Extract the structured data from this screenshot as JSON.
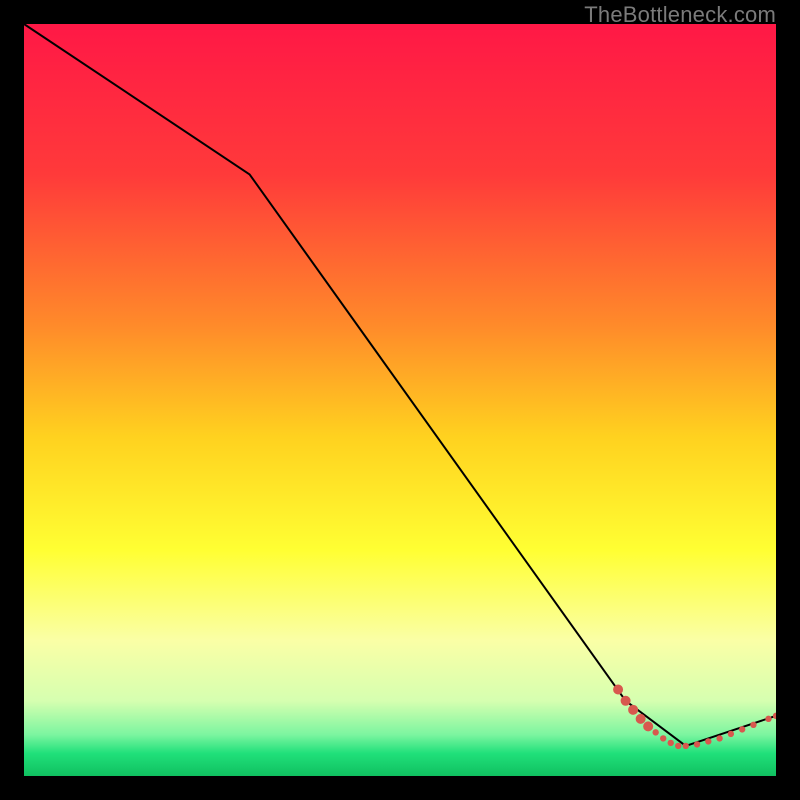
{
  "watermark": "TheBottleneck.com",
  "chart_data": {
    "type": "line",
    "title": "",
    "xlabel": "",
    "ylabel": "",
    "xlim": [
      0,
      100
    ],
    "ylim": [
      0,
      100
    ],
    "grid": false,
    "legend": false,
    "background_gradient_stops": [
      {
        "offset": 0.0,
        "color": "#ff1846"
      },
      {
        "offset": 0.2,
        "color": "#ff3a3a"
      },
      {
        "offset": 0.4,
        "color": "#ff8a2a"
      },
      {
        "offset": 0.55,
        "color": "#ffd21f"
      },
      {
        "offset": 0.7,
        "color": "#ffff33"
      },
      {
        "offset": 0.82,
        "color": "#faffa6"
      },
      {
        "offset": 0.9,
        "color": "#d6ffb0"
      },
      {
        "offset": 0.945,
        "color": "#7cf5a0"
      },
      {
        "offset": 0.97,
        "color": "#20e07a"
      },
      {
        "offset": 1.0,
        "color": "#10c060"
      }
    ],
    "series": [
      {
        "name": "curve",
        "stroke": "#000000",
        "stroke_width": 2,
        "x": [
          0,
          30,
          80,
          88,
          100
        ],
        "y": [
          100,
          80,
          10,
          4,
          8
        ]
      }
    ],
    "marker_clusters": [
      {
        "name": "tail-dots",
        "color": "#d8584e",
        "radius_small": 3.2,
        "radius_large": 5.0,
        "points": [
          {
            "x": 79.0,
            "y": 11.5,
            "r": "large"
          },
          {
            "x": 80.0,
            "y": 10.0,
            "r": "large"
          },
          {
            "x": 81.0,
            "y": 8.8,
            "r": "large"
          },
          {
            "x": 82.0,
            "y": 7.6,
            "r": "large"
          },
          {
            "x": 83.0,
            "y": 6.6,
            "r": "large"
          },
          {
            "x": 84.0,
            "y": 5.8,
            "r": "small"
          },
          {
            "x": 85.0,
            "y": 5.0,
            "r": "small"
          },
          {
            "x": 86.0,
            "y": 4.4,
            "r": "small"
          },
          {
            "x": 87.0,
            "y": 4.0,
            "r": "small"
          },
          {
            "x": 88.0,
            "y": 4.0,
            "r": "small"
          },
          {
            "x": 89.5,
            "y": 4.2,
            "r": "small"
          },
          {
            "x": 91.0,
            "y": 4.6,
            "r": "small"
          },
          {
            "x": 92.5,
            "y": 5.0,
            "r": "small"
          },
          {
            "x": 94.0,
            "y": 5.6,
            "r": "small"
          },
          {
            "x": 95.5,
            "y": 6.2,
            "r": "small"
          },
          {
            "x": 97.0,
            "y": 6.8,
            "r": "small"
          },
          {
            "x": 99.0,
            "y": 7.6,
            "r": "small"
          },
          {
            "x": 100.0,
            "y": 8.0,
            "r": "small"
          }
        ]
      }
    ]
  }
}
